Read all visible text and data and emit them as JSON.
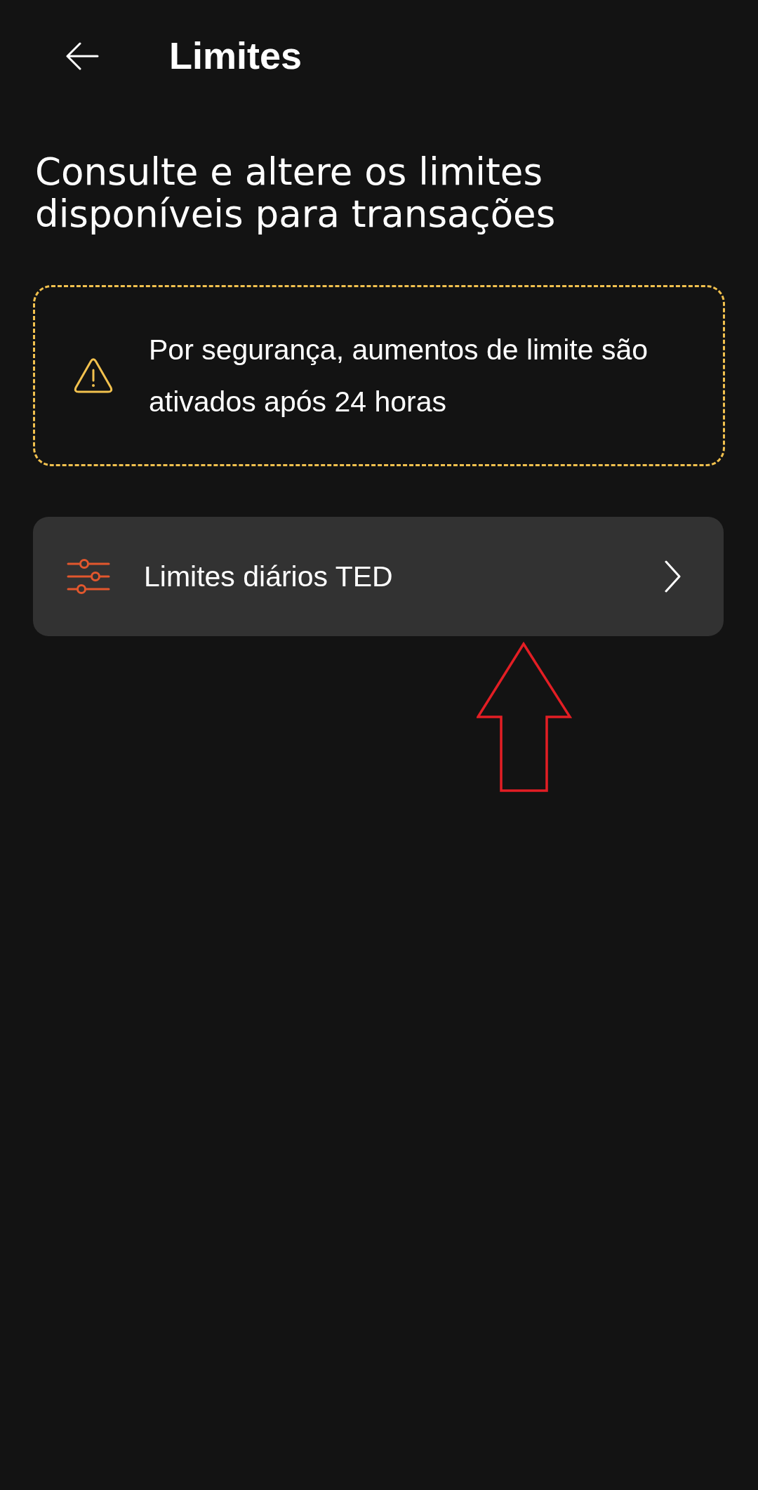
{
  "header": {
    "title": "Limites"
  },
  "heading": "Consulte e altere os limites disponíveis para transações",
  "notice": {
    "text": "Por segurança, aumentos de limite são ativados após 24 horas"
  },
  "menu_items": [
    {
      "label": "Limites diários TED"
    }
  ],
  "annotations": [
    {
      "kind": "arrow"
    }
  ]
}
